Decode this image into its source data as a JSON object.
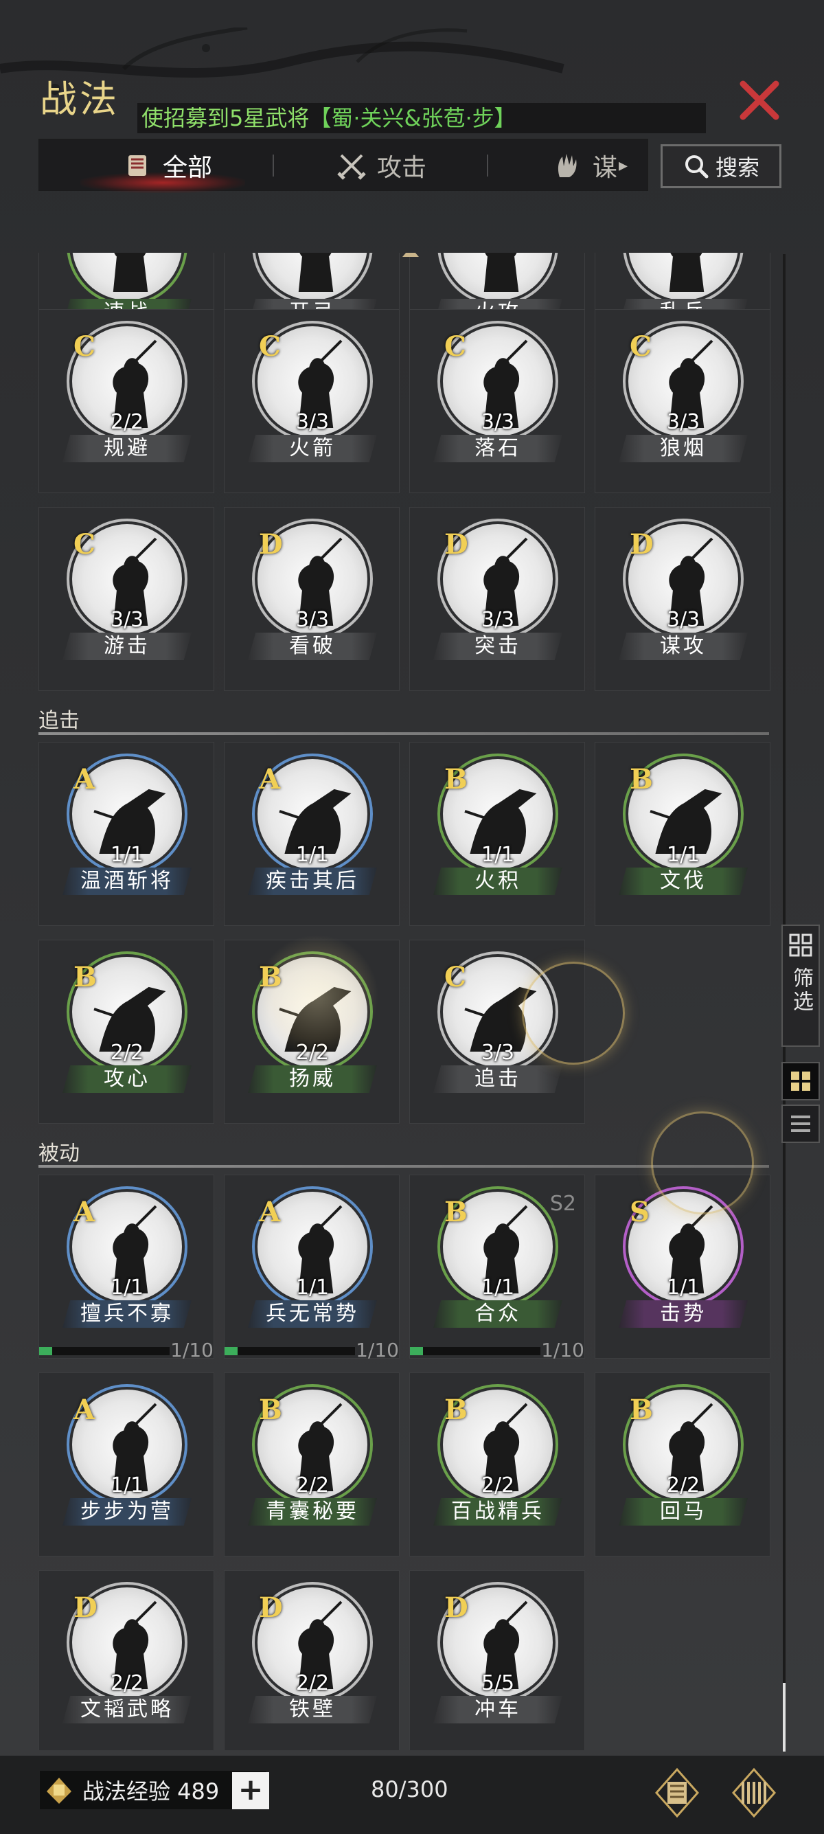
{
  "header": {
    "title": "战法",
    "notice_prefix": "使招募到5星武将",
    "notice_highlight": "【蜀·关兴&张苞·步】",
    "close_icon": "close-icon"
  },
  "tabs": [
    {
      "label": "全部",
      "icon": "scroll-icon",
      "active": true
    },
    {
      "label": "攻击",
      "icon": "crossed-swords-icon",
      "active": false
    },
    {
      "label": "谋",
      "icon": "hand-icon",
      "active": false
    }
  ],
  "search": {
    "label": "搜索"
  },
  "sections": {
    "pursuit": "追击",
    "passive": "被动"
  },
  "rows": {
    "partial_top": [
      {
        "name": "速战",
        "color": "green"
      },
      {
        "name": "开弓",
        "color": "grey"
      },
      {
        "name": "火攻",
        "color": "grey"
      },
      {
        "name": "乱兵",
        "color": "grey"
      }
    ],
    "row1": [
      {
        "grade": "C",
        "count": "2/2",
        "name": "规避",
        "color": "grey"
      },
      {
        "grade": "C",
        "count": "3/3",
        "name": "火箭",
        "color": "grey"
      },
      {
        "grade": "C",
        "count": "3/3",
        "name": "落石",
        "color": "grey"
      },
      {
        "grade": "C",
        "count": "3/3",
        "name": "狼烟",
        "color": "grey"
      }
    ],
    "row2": [
      {
        "grade": "C",
        "count": "3/3",
        "name": "游击",
        "color": "grey"
      },
      {
        "grade": "D",
        "count": "3/3",
        "name": "看破",
        "color": "grey"
      },
      {
        "grade": "D",
        "count": "3/3",
        "name": "突击",
        "color": "grey"
      },
      {
        "grade": "D",
        "count": "3/3",
        "name": "谋攻",
        "color": "grey"
      }
    ],
    "row3": [
      {
        "grade": "A",
        "count": "1/1",
        "name": "温酒斩将",
        "color": "blue"
      },
      {
        "grade": "A",
        "count": "1/1",
        "name": "疾击其后",
        "color": "blue"
      },
      {
        "grade": "B",
        "count": "1/1",
        "name": "火积",
        "color": "green"
      },
      {
        "grade": "B",
        "count": "1/1",
        "name": "文伐",
        "color": "green"
      }
    ],
    "row4": [
      {
        "grade": "B",
        "count": "2/2",
        "name": "攻心",
        "color": "green"
      },
      {
        "grade": "B",
        "count": "2/2",
        "name": "扬威",
        "color": "green"
      },
      {
        "grade": "C",
        "count": "3/3",
        "name": "追击",
        "color": "grey"
      }
    ],
    "row5": [
      {
        "grade": "A",
        "count": "1/1",
        "name": "擅兵不寡",
        "color": "blue",
        "progress": "1/10",
        "progress_frac": 0.1
      },
      {
        "grade": "A",
        "count": "1/1",
        "name": "兵无常势",
        "color": "blue",
        "progress": "1/10",
        "progress_frac": 0.1
      },
      {
        "grade": "B",
        "count": "1/1",
        "name": "合众",
        "color": "green",
        "season": "S2",
        "progress": "1/10",
        "progress_frac": 0.1
      },
      {
        "grade": "S",
        "count": "1/1",
        "name": "击势",
        "color": "purple"
      }
    ],
    "row6": [
      {
        "grade": "A",
        "count": "1/1",
        "name": "步步为营",
        "color": "blue"
      },
      {
        "grade": "B",
        "count": "2/2",
        "name": "青囊秘要",
        "color": "green"
      },
      {
        "grade": "B",
        "count": "2/2",
        "name": "百战精兵",
        "color": "green"
      },
      {
        "grade": "B",
        "count": "2/2",
        "name": "回马",
        "color": "green"
      }
    ],
    "row7": [
      {
        "grade": "D",
        "count": "2/2",
        "name": "文韬武略",
        "color": "grey"
      },
      {
        "grade": "D",
        "count": "2/2",
        "name": "铁壁",
        "color": "grey"
      },
      {
        "grade": "D",
        "count": "5/5",
        "name": "冲车",
        "color": "grey"
      }
    ]
  },
  "side": {
    "filter_label": "筛选"
  },
  "footer": {
    "exp_label": "战法经验 489",
    "plus": "+",
    "capacity": "80/300"
  }
}
